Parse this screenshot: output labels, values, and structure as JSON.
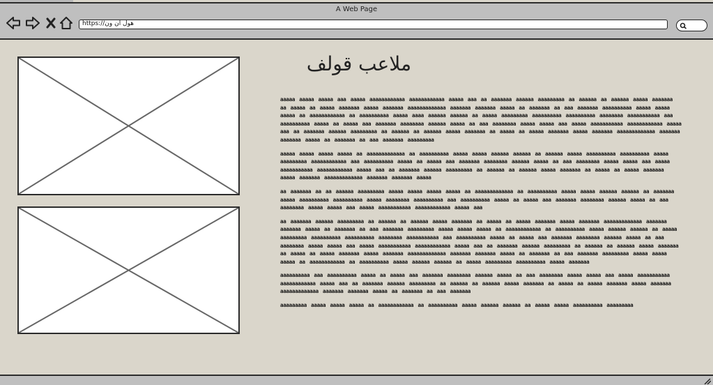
{
  "window": {
    "title": "A Web Page"
  },
  "toolbar": {
    "icons": [
      "back-arrow-icon",
      "forward-arrow-icon",
      "close-x-icon",
      "home-icon"
    ],
    "url": "https://هول ان ون"
  },
  "search": {
    "icon": "search-icon"
  },
  "main": {
    "title": "ملاعب قولف",
    "images": [
      "image-placeholder-1",
      "image-placeholder-2"
    ],
    "paragraphs": [
      "aaaaa aaaaa aaaaa aaa aaaaa aaaaaaaaaaaa aaaaaaaaaaaa aaaaa aaa aa aaaaaaa aaaaaa aaaaaaaaa aa aaaaaa aa aaaaaa aaaaa aaaaaaa aa aaaaa aa aaaaa aaaaaaa aaaaa aaaaaaa aaaaaaaaaaaaa aaaaaaa aaaaaaa aaaaa aa aaaaaaa aa aaa aaaaaaa aaaaaaaaaa aaaaa aaaaa aaaaa aa aaaaaaaaaaaa aa aaaaaaaaaa aaaaa aaaa aaaaaa aaaaaa aa aaaaa aaaaaaaaa aaaaaaaaaa aaaaaaaaaa aaaaaaaa aaaaaaaaaaa aaa aaaaaaaaaa aaaaa aa aaaaa aaa aaaaaaa aaaaaaaa aaaaaa aaaaa aa aaa aaaaaaaa aaaaa aaaaa aaa aaaaa aaaaaaaaaaa aaaaaaaaaaaa aaaaa aaa aa aaaaaaa aaaaaa aaaaaaaaa aa aaaaaa aa aaaaaa aaaaa aaaaaaa aa aaaaa aa aaaaa aaaaaaa aaaaa aaaaaaa aaaaaaaaaaaaa aaaaaaa aaaaaaa aaaaa aa aaaaaaa aa aaa aaaaaaa aaaaaaaaa",
      "aaaaa aaaaa aaaaa aaaaa aa aaaaaaaaaaaaa aa aaaaaaaaaa aaaaa aaaaa aaaaaa aaaaaa aa aaaaaa aaaaa aaaaaaaaaa aaaaaaaaaa aaaaa aaaaaaaaa aaaaaaaaaaaa aaa aaaaaaaaaa aaaaa aa aaaaa aaa aaaaaaa aaaaaaaa aaaaaa aaaaa aa aaa aaaaaaaa aaaaa aaaaa aaa aaaaa aaaaaaaaaaa aaaaaaaaaaaa aaaaa aaa aa aaaaaaa aaaaaa aaaaaaaaa aa aaaaaa aa aaaaaa aaaaa aaaaaaa aa aaaaa aa aaaaa aaaaaaa aaaaa aaaaaaa aaaaaaaaaaaaa aaaaaaa aaaaaaa aaaaa",
      "aa aaaaaaa aa aa aaaaaa aaaaaaaaa aaaaa aaaaa aaaaa aaaaa aa aaaaaaaaaaaaa aa aaaaaaaaaa aaaaa aaaaa aaaaaa aaaaaa aa aaaaaaa aaaaa aaaaaaaaaa aaaaaaaaaa aaaaa aaaaaaaa aaaaaaaaaa aaa aaaaaaaaaa aaaaa aa aaaaa aaa aaaaaaa aaaaaaaa aaaaaa aaaaa aa aaa aaaaaaaa aaaaa aaaaa aaa aaaaa aaaaaaaaaaa aaaaaaaaaaaa aaaaa aaa",
      "aa aaaaaaa aaaaaa aaaaaaaaa aa aaaaaa aa aaaaaa aaaaa aaaaaaa aa aaaaa aa aaaaa aaaaaaa aaaaa aaaaaaa aaaaaaaaaaaaa aaaaaaa aaaaaaa aaaaa aa aaaaaaa aa aaa aaaaaaa aaaaaaaaa aaaaa aaaaa aaaaa aa aaaaaaaaaaaa aa aaaaaaaaaa aaaaa aaaaaa aaaaaa aa aaaaa aaaaaaaaa aaaaaaaaaa aaaaaaaaaa aaaaaaaa aaaaaaaaaaa aaa aaaaaaaaaa aaaaa aa aaaaa aaa aaaaaaa aaaaaaaa aaaaaa aaaaa aa aaa aaaaaaaa aaaaa aaaaa aaa aaaaa aaaaaaaaaaa aaaaaaaaaaaa aaaaa aaa aa aaaaaaa aaaaaa aaaaaaaaa aa aaaaaa aa aaaaaa aaaaa aaaaaaa aa aaaaa aa aaaaa aaaaaaa aaaaa aaaaaaa aaaaaaaaaaaaa aaaaaaa aaaaaaa aaaaa aa aaaaaaa aa aaa aaaaaaa aaaaaaaaa aaaaa aaaaa aaaaa aa aaaaaaaaaaaa aa aaaaaaaaaa aaaaa aaaaaa aaaaaa aa aaaaa aaaaaaaaa aaaaaaaaaa aaaaa aaaaaaa",
      "aaaaaaaaaa aaa aaaaaaaaaa aaaaa aa aaaaa aaa aaaaaaa aaaaaaaa aaaaaa aaaaa aa aaa aaaaaaaa aaaaa aaaaa aaa aaaaa aaaaaaaaaaa aaaaaaaaaaaa aaaaa aaa aa aaaaaaa aaaaaa aaaaaaaaa aa aaaaaa aa aaaaaa aaaaa aaaaaaa aa aaaaa aa aaaaa aaaaaaa aaaaa aaaaaaa aaaaaaaaaaaaa aaaaaaa aaaaaaa aaaaa aa aaaaaaa aa aaa aaaaaaa",
      "aaaaaaaaa aaaaa aaaaa aaaaa aa aaaaaaaaaaaa aa aaaaaaaaaa aaaaa aaaaaa aaaaaa aa aaaaa aaaaa aaaaaaaaaa aaaaaaaaa"
    ]
  }
}
